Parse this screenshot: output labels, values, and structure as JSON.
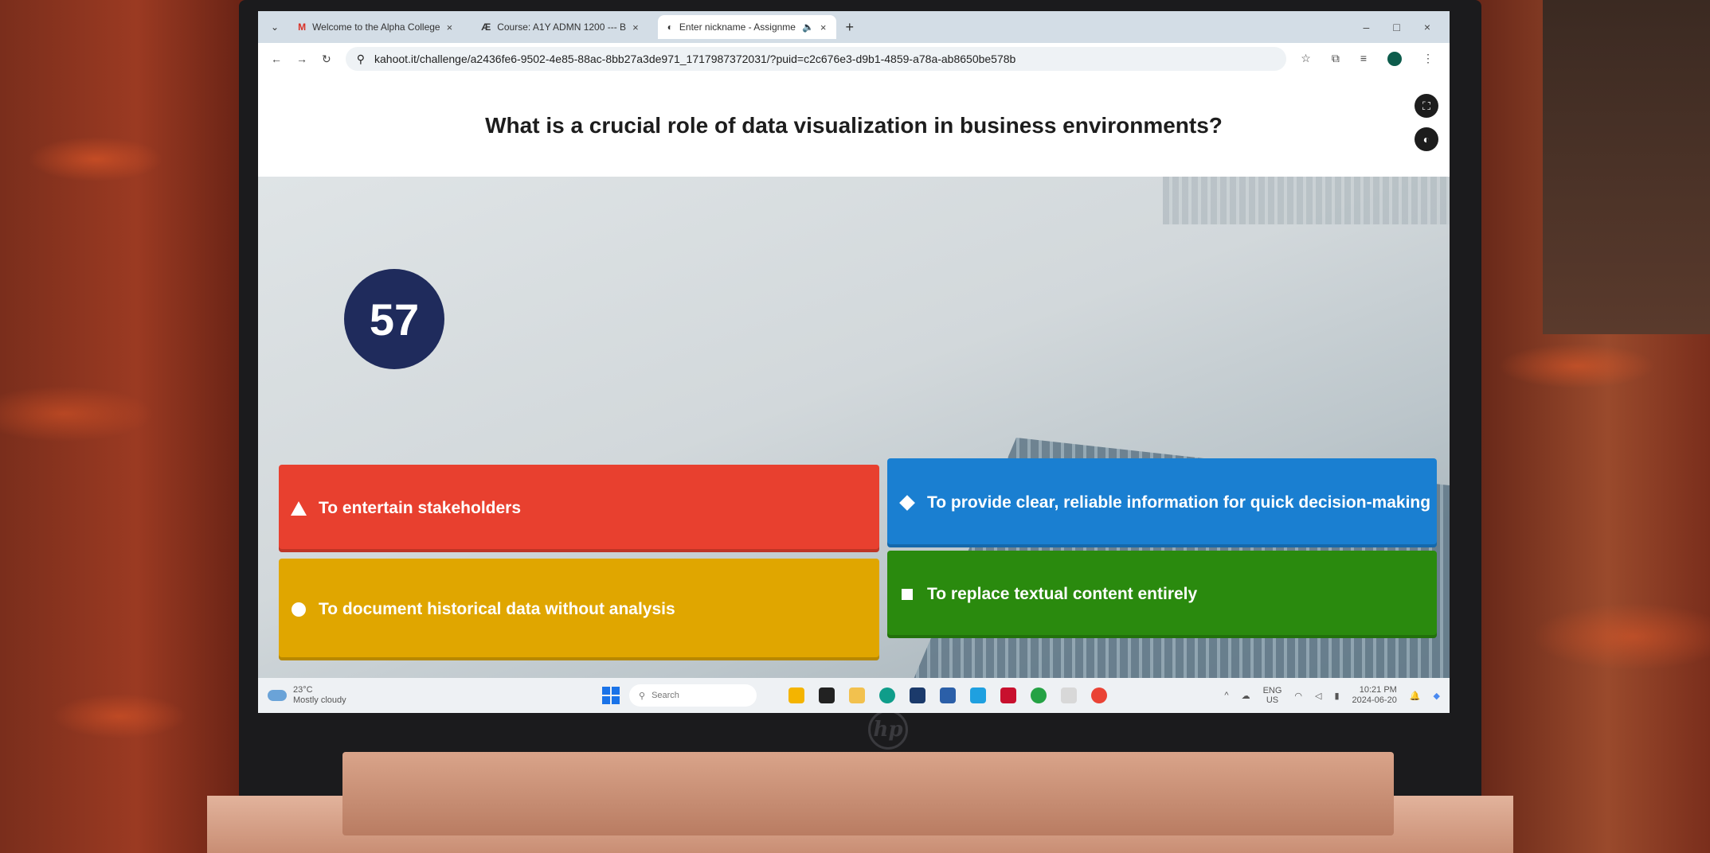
{
  "browser": {
    "tabs": [
      {
        "label": "Welcome to the Alpha College",
        "icon": "gmail-icon",
        "active": false
      },
      {
        "label": "Course: A1Y ADMN 1200 --- B",
        "icon": "course-icon",
        "active": false
      },
      {
        "label": "Enter nickname - Assignme",
        "icon": "kahoot-icon",
        "active": true
      }
    ],
    "url": "kahoot.it/challenge/a2436fe6-9502-4e85-88ac-8bb27a3de971_1717987372031/?puid=c2c676e3-d9b1-4859-a78a-ab8650be578b"
  },
  "quiz": {
    "question": "What is a crucial role of data visualization in business environments?",
    "timer": "57",
    "answers": {
      "red": "To entertain stakeholders",
      "blue": "To provide clear, reliable information for quick decision-making",
      "yellow": "To document historical data without analysis",
      "green": "To replace textual content entirely"
    }
  },
  "taskbar": {
    "temperature": "23°C",
    "weather": "Mostly cloudy",
    "search_placeholder": "Search",
    "lang": "ENG",
    "region": "US",
    "time": "10:21 PM",
    "date": "2024-06-20"
  },
  "colors": {
    "red": "#e8402f",
    "blue": "#1a7fd1",
    "yellow": "#e0a600",
    "green": "#2a8a0e",
    "timer_bg": "#1f2b5c"
  }
}
